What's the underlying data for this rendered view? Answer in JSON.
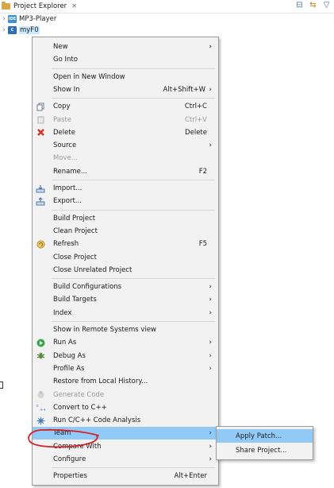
{
  "view": {
    "title": "Project Explorer",
    "close_symbol": "✕",
    "actions": [
      {
        "name": "collapse-all-icon",
        "glyph": "⊟"
      },
      {
        "name": "link-with-editor-icon",
        "glyph": "⇆"
      },
      {
        "name": "filter-icon",
        "glyph": "▽"
      }
    ]
  },
  "tree": {
    "items": [
      {
        "label": "MP3-Player",
        "icon_text": "IDE"
      },
      {
        "label": "myF0",
        "icon_text": "C"
      }
    ]
  },
  "menu": {
    "items": [
      {
        "label": "New",
        "submenu": true
      },
      {
        "label": "Go Into"
      },
      {
        "sep": true
      },
      {
        "label": "Open in New Window"
      },
      {
        "label": "Show In",
        "accel": "Alt+Shift+W",
        "submenu": true
      },
      {
        "sep": true
      },
      {
        "label": "Copy",
        "accel": "Ctrl+C",
        "icon": "copy-icon"
      },
      {
        "label": "Paste",
        "accel": "Ctrl+V",
        "icon": "paste-icon",
        "disabled": true
      },
      {
        "label": "Delete",
        "accel": "Delete",
        "icon": "delete-icon"
      },
      {
        "label": "Source",
        "submenu": true
      },
      {
        "label": "Move...",
        "disabled": true
      },
      {
        "label": "Rename...",
        "accel": "F2"
      },
      {
        "sep": true
      },
      {
        "label": "Import...",
        "icon": "import-icon"
      },
      {
        "label": "Export...",
        "icon": "export-icon"
      },
      {
        "sep": true
      },
      {
        "label": "Build Project"
      },
      {
        "label": "Clean Project"
      },
      {
        "label": "Refresh",
        "accel": "F5",
        "icon": "refresh-icon"
      },
      {
        "label": "Close Project"
      },
      {
        "label": "Close Unrelated Project"
      },
      {
        "sep": true
      },
      {
        "label": "Build Configurations",
        "submenu": true
      },
      {
        "label": "Build Targets",
        "submenu": true
      },
      {
        "label": "Index",
        "submenu": true
      },
      {
        "sep": true
      },
      {
        "label": "Show in Remote Systems view"
      },
      {
        "label": "Run As",
        "submenu": true,
        "icon": "run-icon"
      },
      {
        "label": "Debug As",
        "submenu": true,
        "icon": "debug-icon"
      },
      {
        "label": "Profile As",
        "submenu": true
      },
      {
        "label": "Restore from Local History..."
      },
      {
        "label": "Generate Code",
        "disabled": true,
        "icon": "generate-code-icon"
      },
      {
        "label": "Convert to C++",
        "icon": "convert-cpp-icon"
      },
      {
        "label": "Run C/C++ Code Analysis",
        "icon": "code-analysis-icon"
      },
      {
        "label": "Team",
        "submenu": true,
        "highlighted": true
      },
      {
        "label": "Compare With",
        "submenu": true
      },
      {
        "label": "Configure",
        "submenu": true
      },
      {
        "sep": true
      },
      {
        "label": "Properties",
        "accel": "Alt+Enter"
      }
    ]
  },
  "submenu": {
    "items": [
      {
        "label": "Apply Patch...",
        "highlighted": true
      },
      {
        "label": "Share Project..."
      }
    ]
  },
  "colors": {
    "highlight": "#91c9f7",
    "annotation": "#d81f26"
  }
}
